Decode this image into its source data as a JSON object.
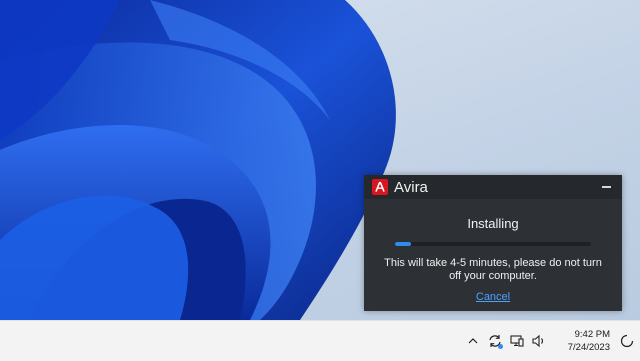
{
  "popup": {
    "app_name": "Avira",
    "status_title": "Installing",
    "progress": 0.08,
    "message": "This will take 4-5 minutes, please do not turn off your computer.",
    "cancel_label": "Cancel",
    "logo_icon": "avira-umbrella-icon",
    "brand_color": "#d7161f",
    "accent_color": "#2f8ceb"
  },
  "taskbar": {
    "tray_icons": [
      "chevron-up-icon",
      "sync-icon",
      "network-icon",
      "volume-icon",
      "notification-icon"
    ],
    "time": "9:42 PM",
    "date": "7/24/2023"
  },
  "wallpaper": {
    "colors": [
      "#0a2fa8",
      "#1f5ee0",
      "#c4d3e6"
    ]
  }
}
